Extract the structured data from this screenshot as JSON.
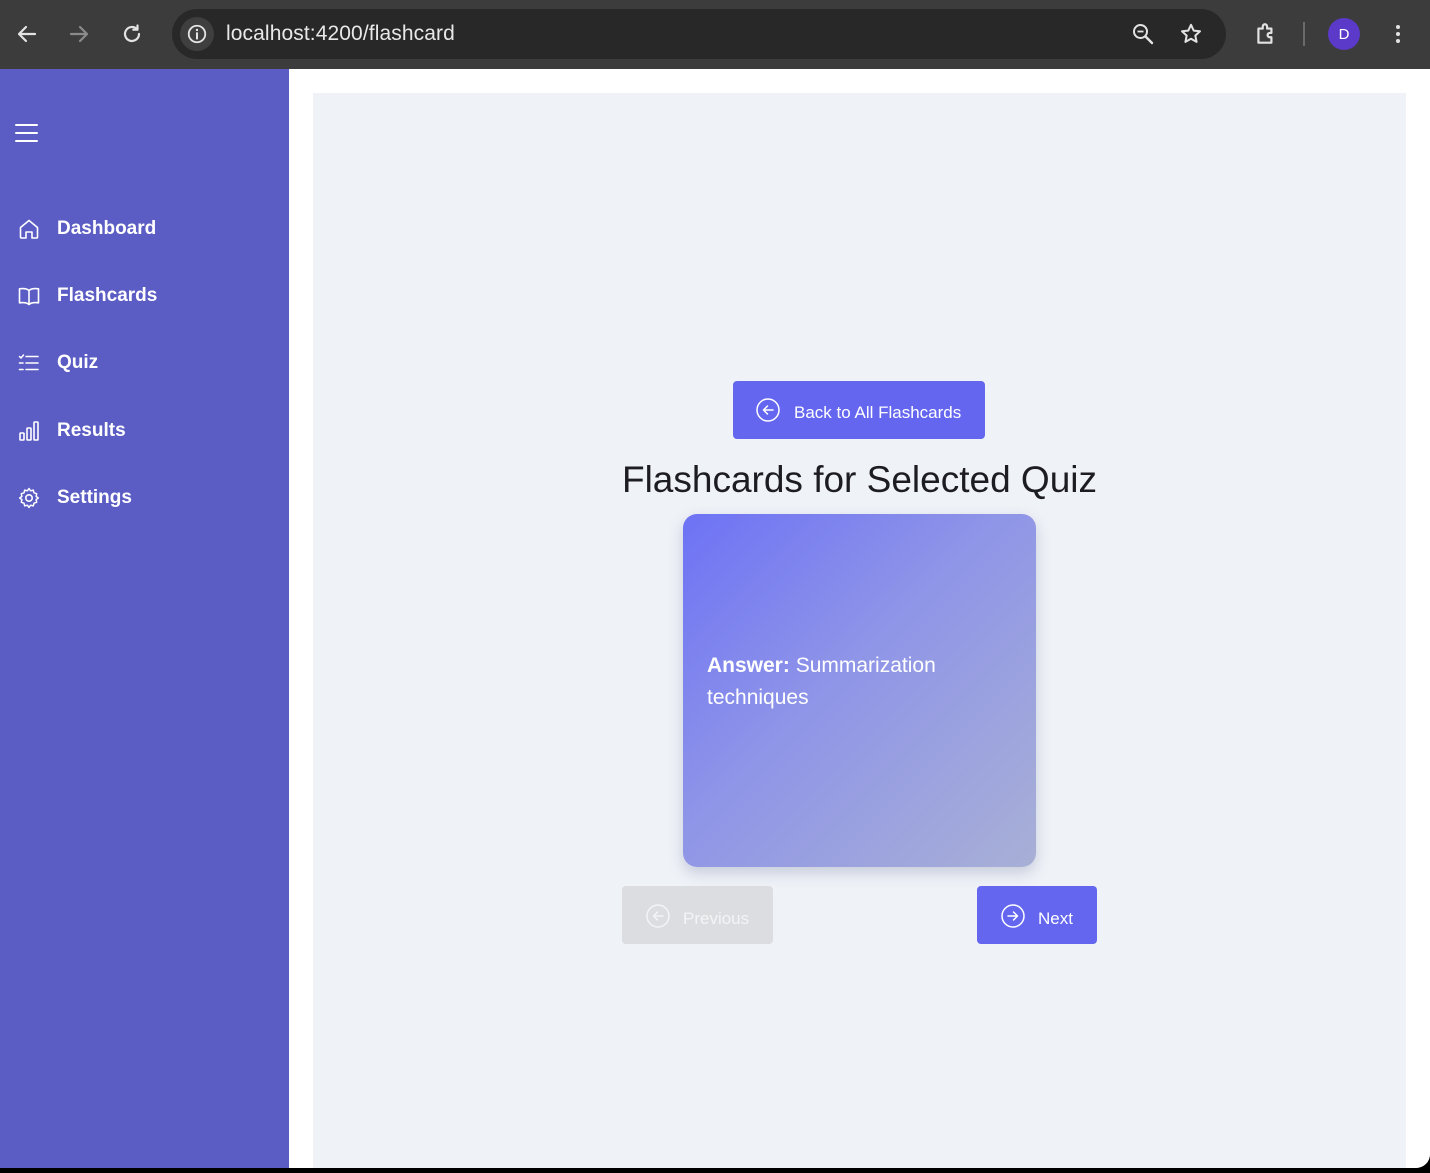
{
  "browser": {
    "url_host": "localhost:4200",
    "url_path": "/flashcard",
    "profile_initial": "D",
    "icons": [
      "back-arrow-icon",
      "forward-arrow-icon",
      "reload-icon",
      "site-info-icon",
      "zoom-icon",
      "bookmark-star-icon",
      "extensions-icon",
      "more-vertical-icon"
    ]
  },
  "sidebar": {
    "items": [
      {
        "label": "Dashboard",
        "icon": "home-icon"
      },
      {
        "label": "Flashcards",
        "icon": "book-icon"
      },
      {
        "label": "Quiz",
        "icon": "list-icon"
      },
      {
        "label": "Results",
        "icon": "bar-chart-icon"
      },
      {
        "label": "Settings",
        "icon": "gear-icon"
      }
    ]
  },
  "main": {
    "back_button_label": "Back to All Flashcards",
    "title": "Flashcards for Selected Quiz",
    "card": {
      "answer_label": "Answer:",
      "answer_text": "Summarization techniques"
    },
    "previous_label": "Previous",
    "next_label": "Next"
  },
  "colors": {
    "sidebar": "#5b5dc4",
    "accent": "#6466ef",
    "panel": "#eff2f7",
    "disabled": "#dcdde0"
  }
}
